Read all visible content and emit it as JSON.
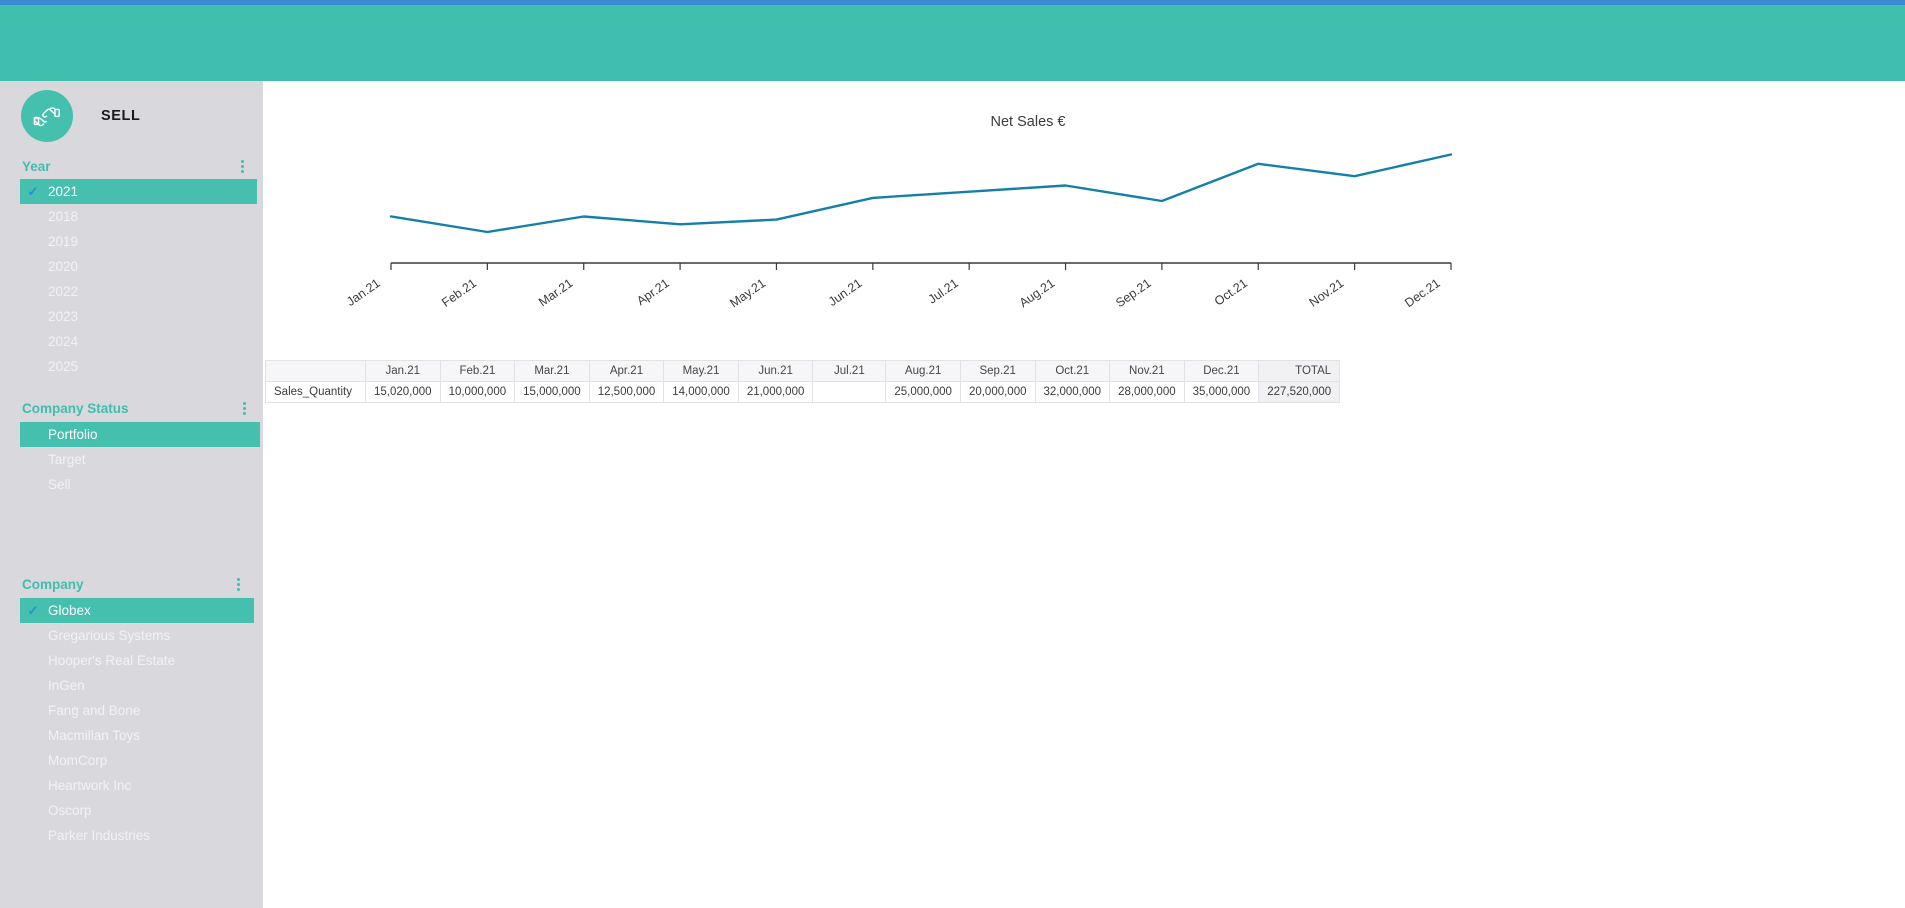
{
  "brand": {
    "title": "SELL",
    "logo_icon": "handshake-money-icon",
    "accent": "#45bfae"
  },
  "theme": {
    "header_band": "#40bfae",
    "top_strip": "#3b8ad1",
    "sidebar_bg": "#d9d9dd",
    "line_color": "#1480a8",
    "check_color": "#2d8fd0"
  },
  "sidebar": {
    "sections": [
      {
        "title": "Year",
        "menu_icon": "more-vertical-icon",
        "items": [
          {
            "label": "2021",
            "selected": true
          },
          {
            "label": "2018",
            "selected": false
          },
          {
            "label": "2019",
            "selected": false
          },
          {
            "label": "2020",
            "selected": false
          },
          {
            "label": "2022",
            "selected": false
          },
          {
            "label": "2023",
            "selected": false
          },
          {
            "label": "2024",
            "selected": false
          },
          {
            "label": "2025",
            "selected": false
          }
        ]
      },
      {
        "title": "Company Status",
        "menu_icon": "more-vertical-icon",
        "items": [
          {
            "label": "Portfolio",
            "selected": true
          },
          {
            "label": "Target",
            "selected": false
          },
          {
            "label": "Sell",
            "selected": false
          }
        ]
      },
      {
        "title": "Company",
        "menu_icon": "more-vertical-icon",
        "items": [
          {
            "label": "Globex",
            "selected": true
          },
          {
            "label": "Gregarious Systems",
            "selected": false
          },
          {
            "label": "Hooper's Real Estate",
            "selected": false
          },
          {
            "label": "InGen",
            "selected": false
          },
          {
            "label": "Fang and Bone",
            "selected": false
          },
          {
            "label": "Macmillan Toys",
            "selected": false
          },
          {
            "label": "MomCorp",
            "selected": false
          },
          {
            "label": "Heartwork Inc",
            "selected": false
          },
          {
            "label": "Oscorp",
            "selected": false
          },
          {
            "label": "Parker Industries",
            "selected": false
          }
        ]
      }
    ]
  },
  "chart_data": {
    "type": "line",
    "title": "Net Sales €",
    "xlabel": "",
    "ylabel": "",
    "grid": false,
    "legend": "none",
    "categories": [
      "Jan.21",
      "Feb.21",
      "Mar.21",
      "Apr.21",
      "May.21",
      "Jun.21",
      "Jul.21",
      "Aug.21",
      "Sep.21",
      "Oct.21",
      "Nov.21",
      "Dec.21"
    ],
    "series": [
      {
        "name": "Sales_Quantity",
        "values": [
          15020000,
          10000000,
          15000000,
          12500000,
          14000000,
          21000000,
          null,
          25000000,
          20000000,
          32000000,
          28000000,
          35000000
        ]
      }
    ],
    "ylim": [
      0,
      40000000
    ]
  },
  "table": {
    "columns": [
      "",
      "Jan.21",
      "Feb.21",
      "Mar.21",
      "Apr.21",
      "May.21",
      "Jun.21",
      "Jul.21",
      "Aug.21",
      "Sep.21",
      "Oct.21",
      "Nov.21",
      "Dec.21",
      "TOTAL"
    ],
    "rows": [
      {
        "label": "Sales_Quantity",
        "cells": [
          "15,020,000",
          "10,000,000",
          "15,000,000",
          "12,500,000",
          "14,000,000",
          "21,000,000",
          "",
          "25,000,000",
          "20,000,000",
          "32,000,000",
          "28,000,000",
          "35,000,000"
        ],
        "total": "227,520,000"
      }
    ]
  }
}
